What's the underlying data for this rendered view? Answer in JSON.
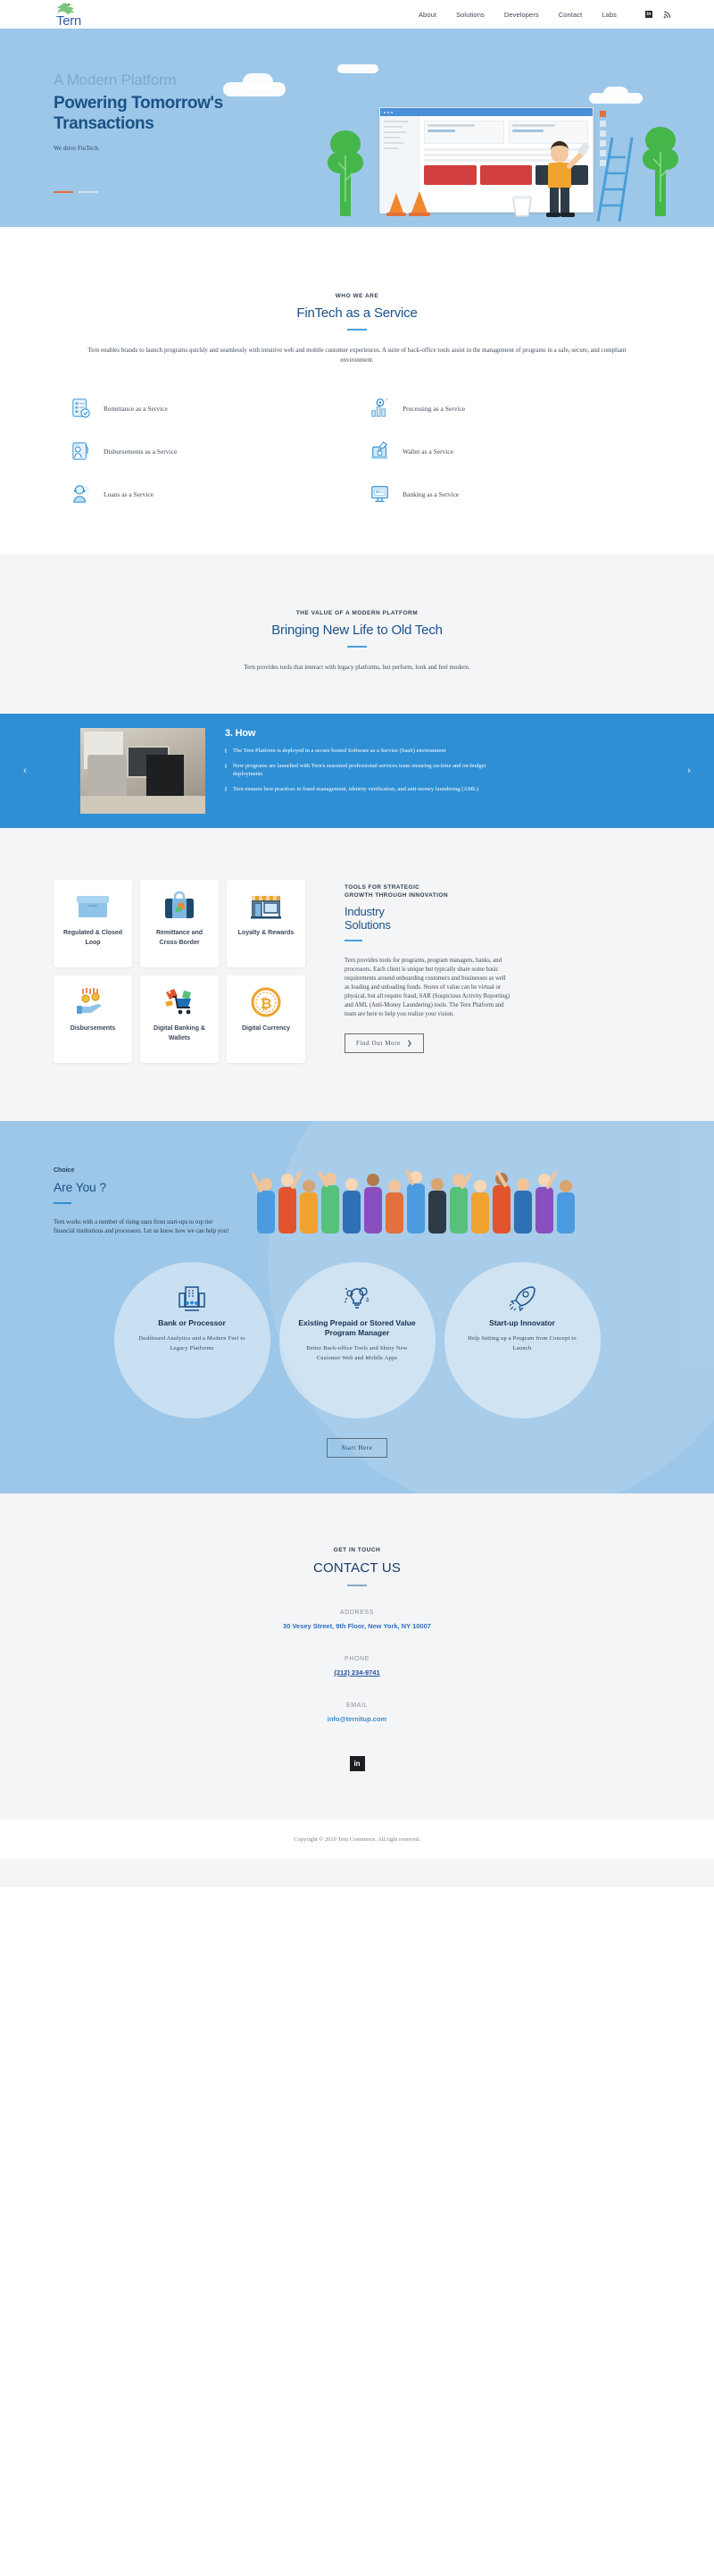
{
  "header": {
    "brand": "Tern",
    "logo_icon": "tern-bird-logo",
    "nav": [
      {
        "label": "About"
      },
      {
        "label": "Solutions"
      },
      {
        "label": "Developers"
      },
      {
        "label": "Contact"
      },
      {
        "label": "Labs"
      }
    ],
    "social": [
      {
        "icon": "linkedin-icon",
        "glyph": "in"
      },
      {
        "icon": "rss-icon",
        "glyph": "≈"
      }
    ]
  },
  "hero": {
    "kicker": "A Modern Platform",
    "title": "Powering Tomorrow's Transactions",
    "subtitle": "We drive FinTech.",
    "slides": 2,
    "active_slide": 1
  },
  "who": {
    "eyebrow": "WHO WE ARE",
    "title": "FinTech as a Service",
    "lead": "Tern enables brands to launch programs quickly and seamlessly with intuitive web and mobile customer experiences. A suite of back-office tools assist in the management of programs in a safe, secure, and compliant environment.",
    "services": [
      {
        "label": "Remittance as a Service",
        "icon": "remittance-checklist-icon"
      },
      {
        "label": "Processing as a Service",
        "icon": "processing-chart-gear-icon"
      },
      {
        "label": "Disbursements as a Service",
        "icon": "disbursements-hand-icon"
      },
      {
        "label": "Wallet as a Service",
        "icon": "wallet-laptop-lock-icon"
      },
      {
        "label": "Loans as a Service",
        "icon": "loans-agent-icon"
      },
      {
        "label": "Banking as a Service",
        "icon": "banking-monitor-icon"
      }
    ]
  },
  "value": {
    "eyebrow": "THE VALUE OF A MODERN PLATFORM",
    "title": "Bringing New Life to Old Tech",
    "lead": "Tern provides tools that interact with legacy platforms, but perform, look and feel modern."
  },
  "carousel": {
    "prev_icon": "chevron-left-icon",
    "next_icon": "chevron-right-icon",
    "prev_glyph": "‹",
    "next_glyph": "›",
    "photo_alt": "desk-workspace-photo",
    "title": "3. How",
    "bullets": [
      "The Tern Platform is deployed in a secure hosted Software as a Service (SaaS) environment",
      "New programs are launched with Tern's seasoned professional services team ensuring on-time and on-budget deployments",
      "Tern ensures best practices in fraud management, identity verification, and anti-money laundering (AML)"
    ]
  },
  "industry": {
    "cards": [
      {
        "label": "Regulated & Closed Loop",
        "icon": "closed-loop-box-icon"
      },
      {
        "label": "Remittance and Cross-Border",
        "icon": "suitcase-travel-icon"
      },
      {
        "label": "Loyalty & Rewards",
        "icon": "storefront-icon"
      },
      {
        "label": "Disbursements",
        "icon": "hand-coins-icon"
      },
      {
        "label": "Digital Banking & Wallets",
        "icon": "shopping-cart-money-icon"
      },
      {
        "label": "Digital Currency",
        "icon": "bitcoin-coin-icon"
      }
    ],
    "eyebrow_line1": "TOOLS FOR STRATEGIC",
    "eyebrow_line2": "GROWTH THROUGH INNOVATION",
    "title_line1": "Industry",
    "title_line2": "Solutions",
    "body": "Tern provides tools for programs, program managers, banks, and processors. Each client is unique but typically share some basic requirements around onboarding customers and businesses as well as loading and unloading funds. Stores of value can be virtual or physical, but all require fraud, SAR (Suspicious Activity Reporting) and AML (Anti-Money Laundering) tools. The Tern Platform and team are here to help you realize your vision.",
    "cta_label": "Find Out More",
    "cta_icon": "chevron-right-icon",
    "cta_glyph": "❯"
  },
  "areyou": {
    "kicker": "Choice",
    "title": "Are You ?",
    "body": "Tern works with a number of rising stars from start-ups to top tier financial institutions and processors. Let us know how we can help you!",
    "illustration": "crowd-of-people-illustration",
    "options": [
      {
        "icon": "bank-building-icon",
        "title": "Bank or Processor",
        "body": "Dashboard Analytics and a Modern Feel to Legacy Platforms"
      },
      {
        "icon": "lightbulb-gears-icon",
        "title": "Existing Prepaid or Stored Value Program Manager",
        "body": "Better Back-office Tools and Shiny New Customer Web and Mobile Apps"
      },
      {
        "icon": "rocket-icon",
        "title": "Start-up Innovator",
        "body": "Help Setting up a Program from Concept to Launch"
      }
    ],
    "cta_label": "Start Here"
  },
  "contact": {
    "eyebrow": "GET IN TOUCH",
    "title": "CONTACT US",
    "address_label": "ADDRESS",
    "address_value": "30 Vesey Street, 9th Floor, New York, NY 10007",
    "phone_label": "PHONE",
    "phone_value": "(212) 234-9741",
    "email_label": "EMAIL",
    "email_value": "info@ternitup.com",
    "social_icon": "linkedin-icon",
    "social_glyph": "in"
  },
  "footer": {
    "copyright": "Copyright © 2019 Tern Commerce. All right reserved."
  },
  "colors": {
    "brand_blue": "#1b5186",
    "accent_blue": "#2f8fd4",
    "hero_bg": "#9dc7e8",
    "light_gray": "#f4f5f7",
    "orange": "#e2703a"
  }
}
